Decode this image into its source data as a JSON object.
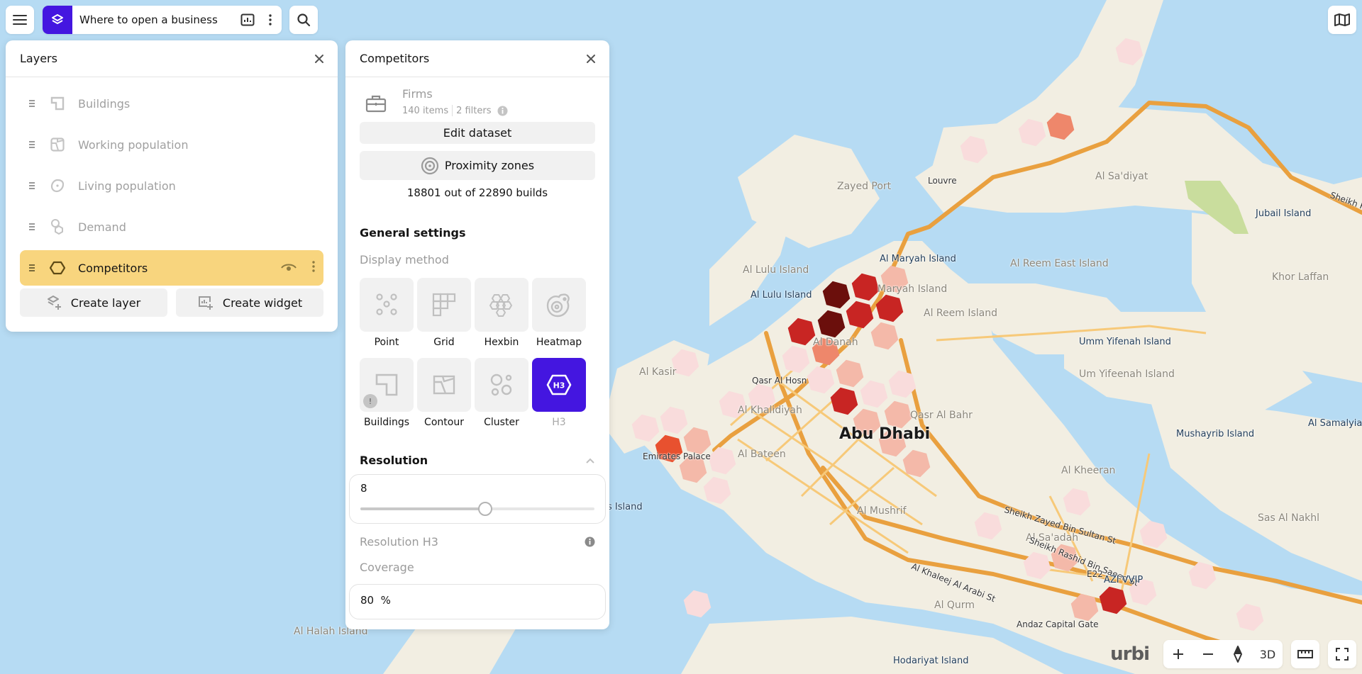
{
  "topbar": {
    "project_title": "Where to open a business",
    "icons": {
      "menu": "hamburger-icon",
      "layers": "layers-icon",
      "dashboard": "bar-chart-icon",
      "more": "vertical-dots-icon",
      "search": "search-icon",
      "map_style": "map-icon"
    }
  },
  "layers_panel": {
    "title": "Layers",
    "items": [
      {
        "label": "Buildings",
        "icon": "building-outline-icon",
        "active": false
      },
      {
        "label": "Working population",
        "icon": "contour-icon",
        "active": false
      },
      {
        "label": "Living population",
        "icon": "heatmap-icon",
        "active": false
      },
      {
        "label": "Demand",
        "icon": "cluster-hex-icon",
        "active": false
      },
      {
        "label": "Competitors",
        "icon": "hexagon-icon",
        "active": true
      }
    ],
    "create_layer": "Create layer",
    "create_widget": "Create widget"
  },
  "competitors_panel": {
    "title": "Competitors",
    "dataset": {
      "name": "Firms",
      "items": "140 items",
      "filters": "2 filters"
    },
    "edit_dataset": "Edit dataset",
    "proximity_zones": "Proximity zones",
    "builds_note": "18801 out of 22890 builds",
    "general_settings": "General settings",
    "display_method_label": "Display method",
    "display_methods": [
      {
        "label": "Point",
        "icon": "point-icon",
        "selected": false
      },
      {
        "label": "Grid",
        "icon": "grid-icon",
        "selected": false
      },
      {
        "label": "Hexbin",
        "icon": "hexbin-icon",
        "selected": false
      },
      {
        "label": "Heatmap",
        "icon": "heatmap-icon",
        "selected": false
      },
      {
        "label": "Buildings",
        "icon": "building-outline-icon",
        "selected": false,
        "warning": "!"
      },
      {
        "label": "Contour",
        "icon": "contour-icon",
        "selected": false
      },
      {
        "label": "Cluster",
        "icon": "cluster-icon",
        "selected": false
      },
      {
        "label": "H3",
        "icon": "h3-icon",
        "selected": true
      }
    ],
    "resolution": {
      "title": "Resolution",
      "value": "8",
      "min": 0,
      "max": 15,
      "level": 8,
      "sublabel": "Resolution H3"
    },
    "coverage": {
      "label": "Coverage",
      "value": "80",
      "unit": "%"
    }
  },
  "map": {
    "labels": [
      {
        "text": "Zayed Port",
        "cls": ""
      },
      {
        "text": "Louvre",
        "cls": "small"
      },
      {
        "text": "Al Sa'diyat",
        "cls": ""
      },
      {
        "text": "Jubail Island",
        "cls": "dark"
      },
      {
        "text": "Sheikh K",
        "cls": "small"
      },
      {
        "text": "Al Lulu Island",
        "cls": ""
      },
      {
        "text": "Al Lulu Island",
        "cls": "dark"
      },
      {
        "text": "Al Maryah Island",
        "cls": "dark"
      },
      {
        "text": "Al Reem East Island",
        "cls": ""
      },
      {
        "text": "Maryah Island",
        "cls": ""
      },
      {
        "text": "Al Reem Island",
        "cls": ""
      },
      {
        "text": "Khor Laffan",
        "cls": ""
      },
      {
        "text": "Umm Yifenah Island",
        "cls": "dark"
      },
      {
        "text": "Um Yifeenah Island",
        "cls": ""
      },
      {
        "text": "Al Danah",
        "cls": ""
      },
      {
        "text": "Al Kasir",
        "cls": ""
      },
      {
        "text": "Qasr Al Hosn",
        "cls": "small"
      },
      {
        "text": "Al Khalidiyah",
        "cls": ""
      },
      {
        "text": "Qasr Al Bahr",
        "cls": ""
      },
      {
        "text": "Abu Dhabi",
        "cls": "city"
      },
      {
        "text": "Mushayrib Island",
        "cls": "dark"
      },
      {
        "text": "Al Samalyiah",
        "cls": "dark"
      },
      {
        "text": "Emirates Palace",
        "cls": "small"
      },
      {
        "text": "Al Bateen",
        "cls": ""
      },
      {
        "text": "Al Kheeran",
        "cls": ""
      },
      {
        "text": "s Island",
        "cls": "dark"
      },
      {
        "text": "Al Mushrif",
        "cls": ""
      },
      {
        "text": "Sheikh Zayed Bin Sultan St",
        "cls": "small"
      },
      {
        "text": "Sas Al Nakhl",
        "cls": ""
      },
      {
        "text": "Al Sa'adah",
        "cls": ""
      },
      {
        "text": "Sheikh Rashid Bin Saeed St",
        "cls": "small"
      },
      {
        "text": "Al Khaleej Al Arabi St",
        "cls": "small"
      },
      {
        "text": "E22",
        "cls": "small"
      },
      {
        "text": "AZI VVIP",
        "cls": "dark"
      },
      {
        "text": "Al Qurm",
        "cls": ""
      },
      {
        "text": "Andaz Capital Gate",
        "cls": "small"
      },
      {
        "text": "Al Halah Island",
        "cls": ""
      },
      {
        "text": "Hodariyat Island",
        "cls": "dark"
      }
    ],
    "hex_colors": {
      "light": "#f9dcdc",
      "salmon": "#f4b9a9",
      "orange": "#ee876b",
      "orangered": "#e8512f",
      "red": "#c82523",
      "dark": "#6b0f0c"
    },
    "hexes": [
      "light",
      "light",
      "orange",
      "light",
      "salmon",
      "red",
      "dark",
      "red",
      "red",
      "dark",
      "red",
      "salmon",
      "orange",
      "light",
      "salmon",
      "light",
      "light",
      "light",
      "red",
      "salmon",
      "salmon",
      "salmon",
      "salmon",
      "light",
      "light",
      "light",
      "light",
      "light",
      "orangered",
      "salmon",
      "salmon",
      "light",
      "light",
      "light",
      "light",
      "light",
      "light",
      "salmon",
      "light",
      "light",
      "light",
      "red",
      "salmon",
      "light"
    ]
  },
  "map_controls": {
    "brand": "urbi",
    "zoom_in": "+",
    "zoom_out": "−",
    "mode_3d": "3D",
    "icons": {
      "compass": "compass-icon",
      "ruler": "ruler-icon",
      "fullscreen": "fullscreen-icon"
    }
  }
}
